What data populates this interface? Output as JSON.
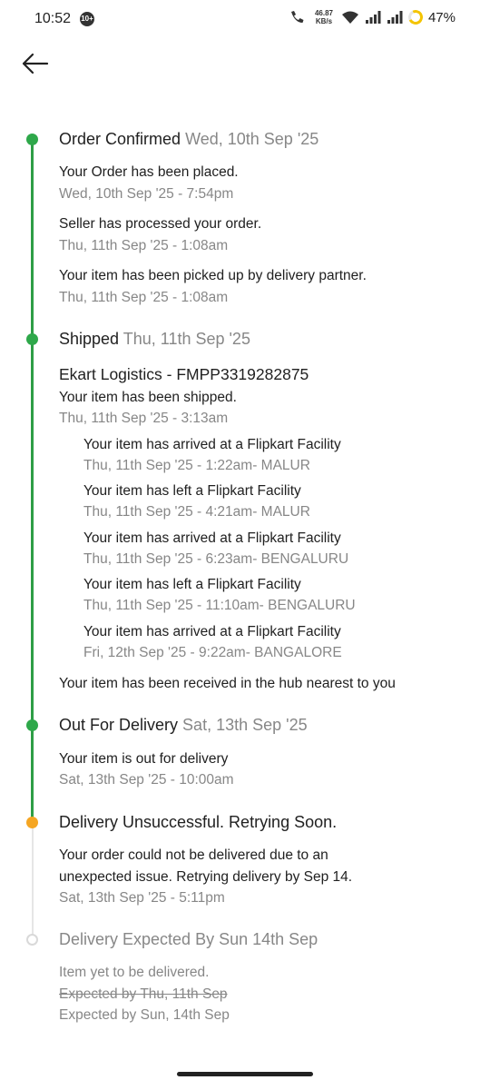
{
  "status_bar": {
    "time": "10:52",
    "notification_badge": "10+",
    "speed_value": "46.87",
    "speed_unit": "KB/s",
    "battery": "47%"
  },
  "header": {
    "back_icon": "arrow-left-icon"
  },
  "timeline": {
    "colors": {
      "done": "#2ea84a",
      "warning": "#f5a623",
      "pending": "#d9d9d9"
    },
    "order_confirmed": {
      "title": "Order Confirmed",
      "date": "Wed, 10th Sep '25",
      "events": [
        {
          "text": "Your Order has been placed.",
          "time": "Wed, 10th Sep '25 - 7:54pm"
        },
        {
          "text": "Seller has processed your order.",
          "time": "Thu, 11th Sep '25 - 1:08am"
        },
        {
          "text": "Your item has been picked up by delivery partner.",
          "time": "Thu, 11th Sep '25 - 1:08am"
        }
      ]
    },
    "shipped": {
      "title": "Shipped",
      "date": "Thu, 11th Sep '25",
      "courier": "Ekart Logistics - FMPP3319282875",
      "shipped_text": "Your item has been shipped.",
      "shipped_time": "Thu, 11th Sep '25 - 3:13am",
      "hops": [
        {
          "text": "Your item has arrived at a Flipkart Facility",
          "time": "Thu, 11th Sep '25 - 1:22am- MALUR"
        },
        {
          "text": "Your item has left a Flipkart Facility",
          "time": "Thu, 11th Sep '25 - 4:21am- MALUR"
        },
        {
          "text": "Your item has arrived at a Flipkart Facility",
          "time": "Thu, 11th Sep '25 - 6:23am- BENGALURU"
        },
        {
          "text": "Your item has left a Flipkart Facility",
          "time": "Thu, 11th Sep '25 - 11:10am- BENGALURU"
        },
        {
          "text": "Your item has arrived at a Flipkart Facility",
          "time": "Fri, 12th Sep '25 - 9:22am- BANGALORE"
        }
      ],
      "hub_text": "Your item has been received in the hub nearest to you"
    },
    "out_for_delivery": {
      "title": "Out For Delivery",
      "date": "Sat, 13th Sep '25",
      "event": {
        "text": "Your item is out for delivery",
        "time": "Sat, 13th Sep '25 - 10:00am"
      }
    },
    "unsuccessful": {
      "title": "Delivery Unsuccessful. Retrying Soon.",
      "text_line1": "Your order could not be delivered due to an",
      "text_line2": "unexpected issue. Retrying delivery by Sep 14.",
      "time": "Sat, 13th Sep '25 - 5:11pm"
    },
    "expected": {
      "title": "Delivery Expected By Sun 14th Sep",
      "text": "Item yet to be delivered.",
      "old_expected": "Expected by Thu, 11th Sep",
      "new_expected": "Expected by Sun, 14th Sep"
    }
  }
}
